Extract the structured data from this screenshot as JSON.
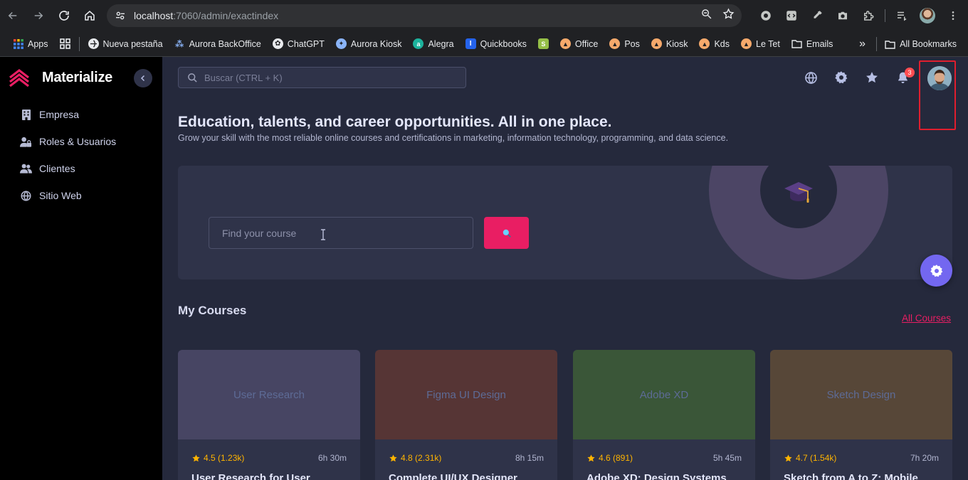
{
  "browser": {
    "url_host": "localhost",
    "url_path": ":7060/admin/exactindex",
    "bookmarks": [
      {
        "label": "Apps",
        "icon": "apps-grid-icon"
      },
      {
        "label": "",
        "icon": "grid-icon"
      },
      {
        "label": "Nueva pestaña",
        "icon": "globe-icon"
      },
      {
        "label": "Aurora BackOffice",
        "icon": "aurora-icon"
      },
      {
        "label": "ChatGPT",
        "icon": "chatgpt-icon"
      },
      {
        "label": "Aurora Kiosk",
        "icon": "aurora-kiosk-icon"
      },
      {
        "label": "Alegra",
        "icon": "alegra-icon"
      },
      {
        "label": "Quickbooks",
        "icon": "quickbooks-icon"
      },
      {
        "label": "",
        "icon": "shopify-icon"
      },
      {
        "label": "Office",
        "icon": "office-icon"
      },
      {
        "label": "Pos",
        "icon": "pos-icon"
      },
      {
        "label": "Kiosk",
        "icon": "kiosk-icon"
      },
      {
        "label": "Kds",
        "icon": "kds-icon"
      },
      {
        "label": "Le Tet",
        "icon": "letet-icon"
      },
      {
        "label": "Emails",
        "icon": "folder-icon"
      }
    ],
    "more_label": "»",
    "all_bookmarks": "All Bookmarks"
  },
  "sidebar": {
    "brand": "Materialize",
    "items": [
      {
        "label": "Empresa",
        "icon": "building-icon"
      },
      {
        "label": "Roles & Usuarios",
        "icon": "user-lock-icon"
      },
      {
        "label": "Clientes",
        "icon": "users-icon"
      },
      {
        "label": "Sitio Web",
        "icon": "globe-icon"
      }
    ]
  },
  "topbar": {
    "search_placeholder": "Buscar (CTRL + K)",
    "notification_count": "3"
  },
  "hero": {
    "title": "Education, talents, and career opportunities. All in one place.",
    "subtitle": "Grow your skill with the most reliable online courses and certifications in marketing, information technology, programming, and data science."
  },
  "course_search": {
    "placeholder": "Find your course"
  },
  "my_courses": {
    "heading": "My Courses",
    "all_link": "All Courses",
    "cards": [
      {
        "image_label": "User Research",
        "rating": "4.5 (1.23k)",
        "duration": "6h 30m",
        "title": "User Research for User",
        "bg": "#474563"
      },
      {
        "image_label": "Figma UI Design",
        "rating": "4.8 (2.31k)",
        "duration": "8h 15m",
        "title": "Complete UI/UX Designer",
        "bg": "#563535"
      },
      {
        "image_label": "Adobe XD",
        "rating": "4.6 (891)",
        "duration": "5h 45m",
        "title": "Adobe XD: Design Systems",
        "bg": "#3a5638"
      },
      {
        "image_label": "Sketch Design",
        "rating": "4.7 (1.54k)",
        "duration": "7h 20m",
        "title": "Sketch from A to Z: Mobile",
        "bg": "#574738"
      }
    ]
  },
  "colors": {
    "accent": "#e91e63",
    "primary": "#7367f0",
    "badge": "#ff4c51",
    "star": "#ffb400"
  }
}
